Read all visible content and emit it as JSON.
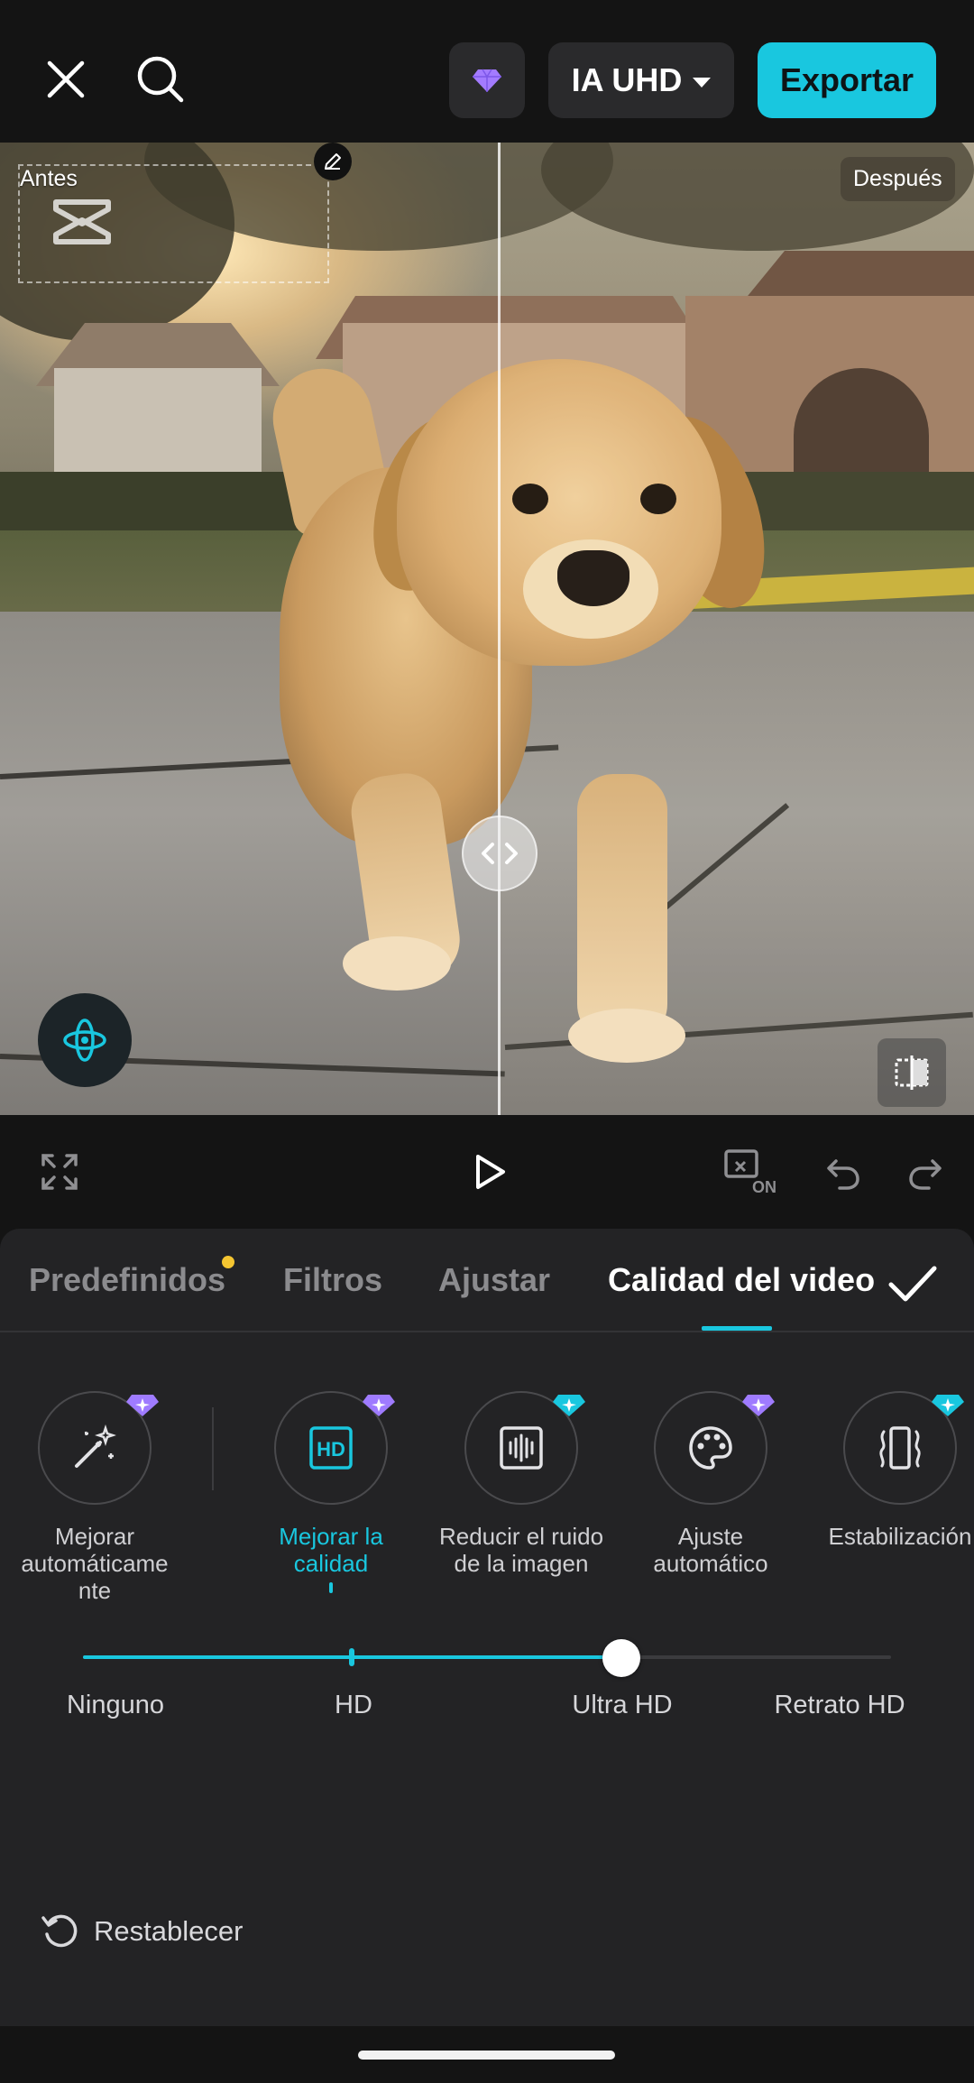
{
  "topbar": {
    "close_icon": "close-icon",
    "search_icon": "search-icon",
    "pro_icon": "diamond-icon",
    "resolution_label": "IA UHD",
    "export_label": "Exportar",
    "accent_color": "#19c7df"
  },
  "preview": {
    "before_label": "Antes",
    "after_label": "Después",
    "compare_split": 0.51
  },
  "playback": {
    "icons": [
      "fullscreen-icon",
      "play-icon",
      "keyframe-on-icon",
      "undo-icon",
      "redo-icon"
    ],
    "keyframe_badge": "ON"
  },
  "panel": {
    "tabs": [
      {
        "label": "Predefinidos",
        "has_dot": true
      },
      {
        "label": "Filtros"
      },
      {
        "label": "Ajustar"
      },
      {
        "label": "Calidad del video",
        "active": true
      }
    ],
    "tools": [
      {
        "label": "Mejorar automáticamente",
        "line1": "Mejorar",
        "line2": "automáticame",
        "line3": "nte",
        "icon": "magic-wand-icon",
        "badge": "purple"
      },
      {
        "label": "Mejorar la calidad",
        "line1": "Mejorar la",
        "line2": "calidad",
        "icon": "hd-icon",
        "badge": "purple",
        "active": true
      },
      {
        "label": "Reducir el ruido de la imagen",
        "line1": "Reducir el ruido",
        "line2": "de la imagen",
        "icon": "denoise-icon",
        "badge": "cyan"
      },
      {
        "label": "Ajuste automático",
        "line1": "Ajuste",
        "line2": "automático",
        "icon": "palette-icon",
        "badge": "purple"
      },
      {
        "label": "Estabilización",
        "line1": "Estabilización",
        "icon": "stabilize-icon",
        "badge": "cyan"
      }
    ],
    "quality_slider": {
      "levels": [
        "Ninguno",
        "HD",
        "Ultra HD",
        "Retrato HD"
      ],
      "selected": "Ultra HD",
      "value_fraction": 0.667
    },
    "reset_label": "Restablecer"
  }
}
